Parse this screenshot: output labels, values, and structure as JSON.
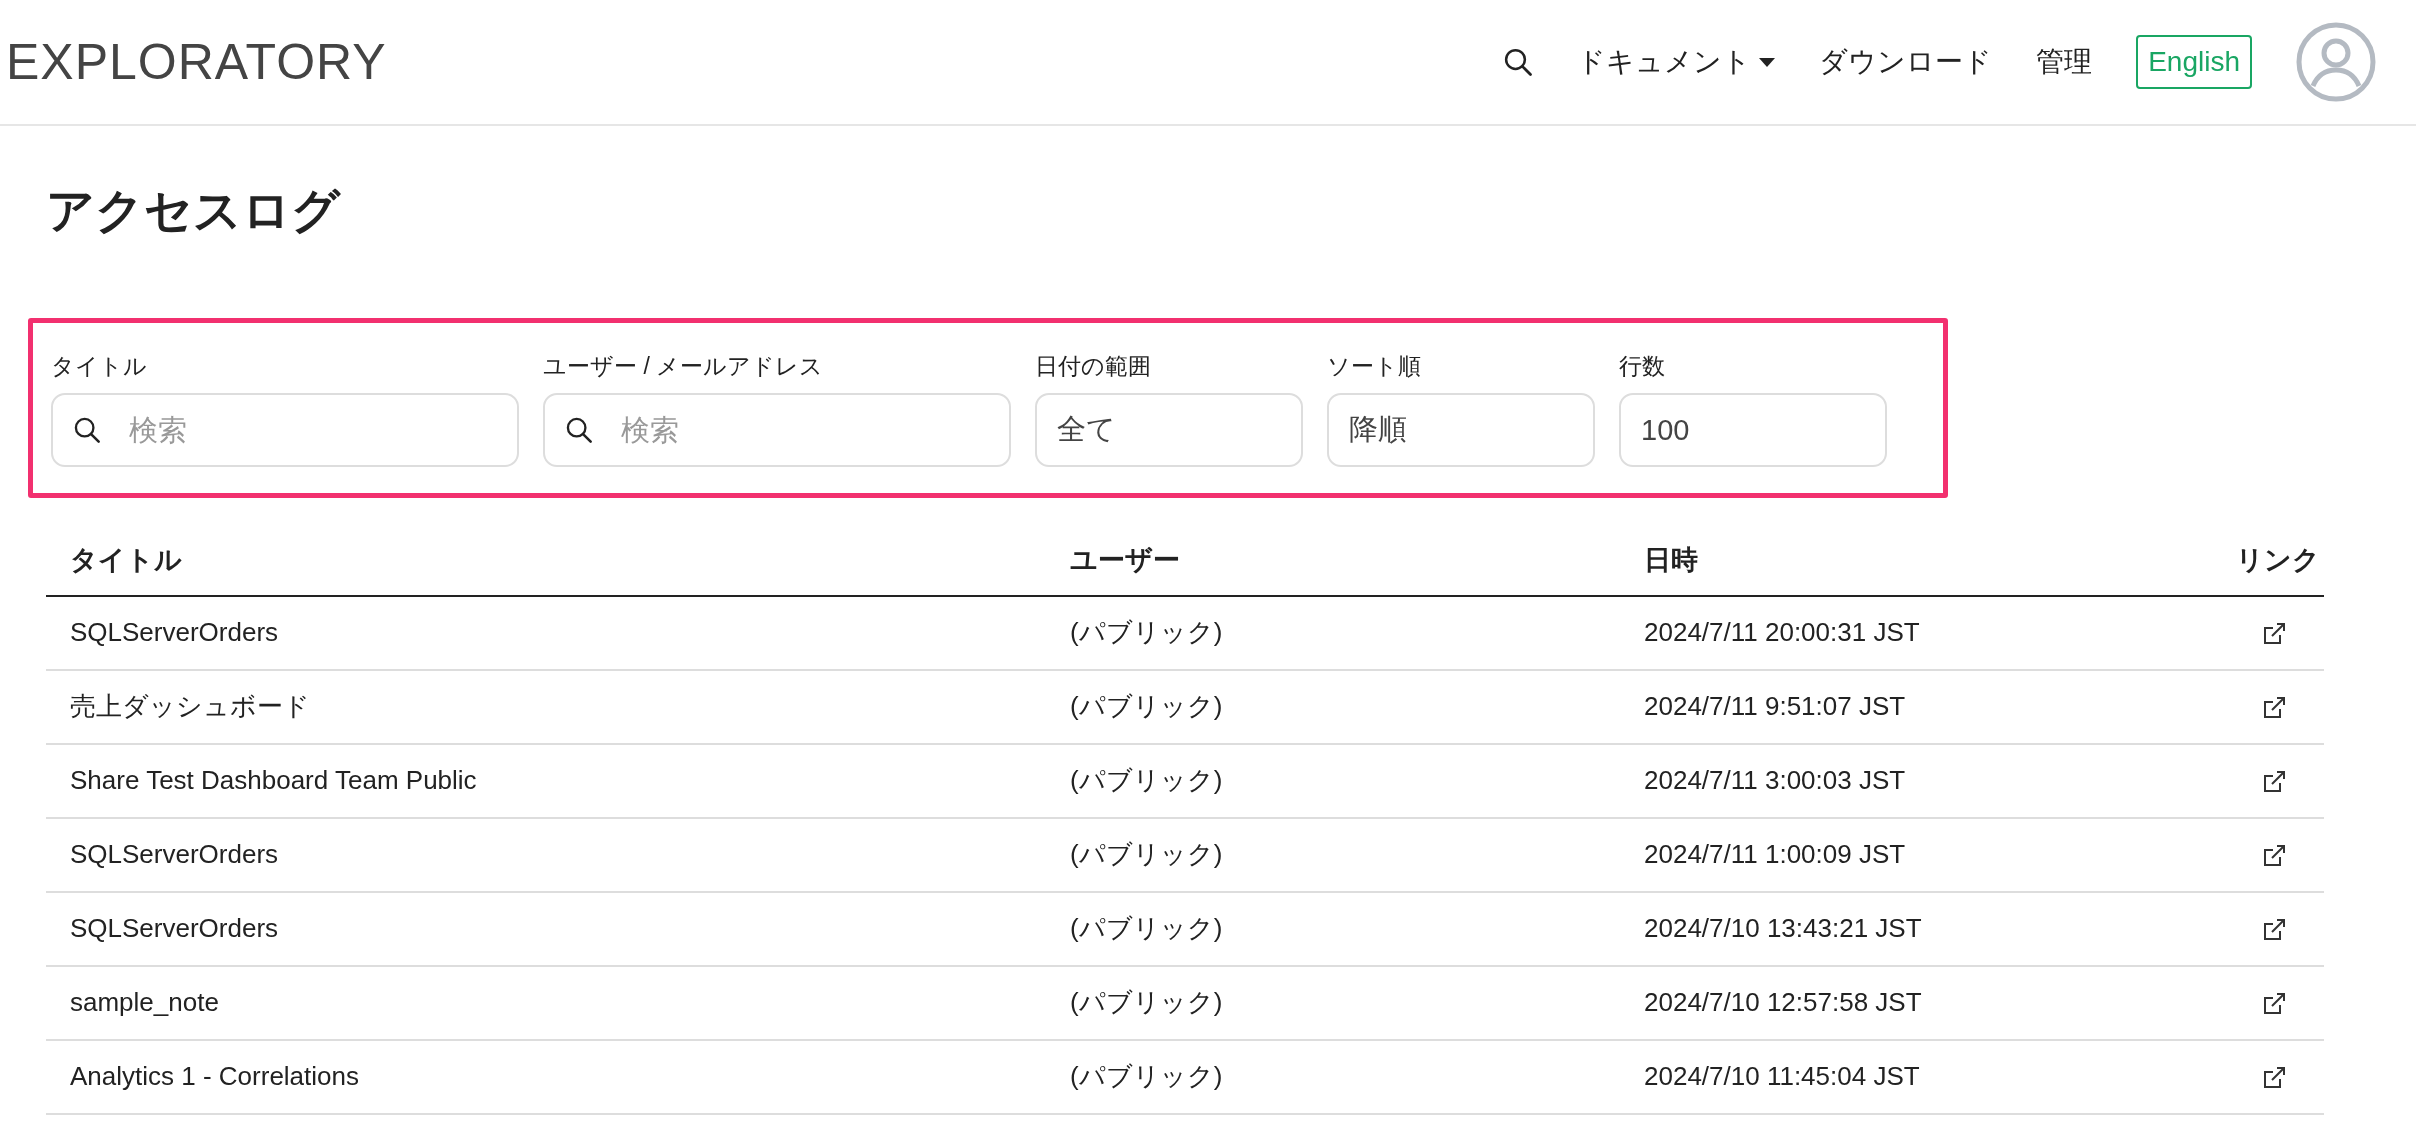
{
  "header": {
    "logo": "EXPLORATORY",
    "nav": [
      {
        "kind": "search"
      },
      {
        "kind": "dropdown",
        "label": "ドキュメント"
      },
      {
        "kind": "link",
        "label": "ダウンロード"
      },
      {
        "kind": "link",
        "label": "管理"
      },
      {
        "kind": "outline",
        "label": "English"
      },
      {
        "kind": "avatar"
      }
    ]
  },
  "page_title": "アクセスログ",
  "filters": [
    {
      "label": "タイトル",
      "kind": "search",
      "placeholder": "検索"
    },
    {
      "label": "ユーザー / メールアドレス",
      "kind": "search",
      "placeholder": "検索"
    },
    {
      "label": "日付の範囲",
      "kind": "text",
      "value": "全て"
    },
    {
      "label": "ソート順",
      "kind": "text",
      "value": "降順"
    },
    {
      "label": "行数",
      "kind": "text",
      "value": "100"
    }
  ],
  "table": {
    "columns": [
      "タイトル",
      "ユーザー",
      "日時",
      "リンク"
    ],
    "rows": [
      {
        "title": "SQLServerOrders",
        "user": "(パブリック)",
        "datetime": "2024/7/11 20:00:31 JST"
      },
      {
        "title": "売上ダッシュボード",
        "user": "(パブリック)",
        "datetime": "2024/7/11 9:51:07 JST"
      },
      {
        "title": "Share Test Dashboard Team Public",
        "user": "(パブリック)",
        "datetime": "2024/7/11 3:00:03 JST"
      },
      {
        "title": "SQLServerOrders",
        "user": "(パブリック)",
        "datetime": "2024/7/11 1:00:09 JST"
      },
      {
        "title": "SQLServerOrders",
        "user": "(パブリック)",
        "datetime": "2024/7/10 13:43:21 JST"
      },
      {
        "title": "sample_note",
        "user": "(パブリック)",
        "datetime": "2024/7/10 12:57:58 JST"
      },
      {
        "title": "Analytics 1 - Correlations",
        "user": "(パブリック)",
        "datetime": "2024/7/10 11:45:04 JST"
      }
    ]
  }
}
